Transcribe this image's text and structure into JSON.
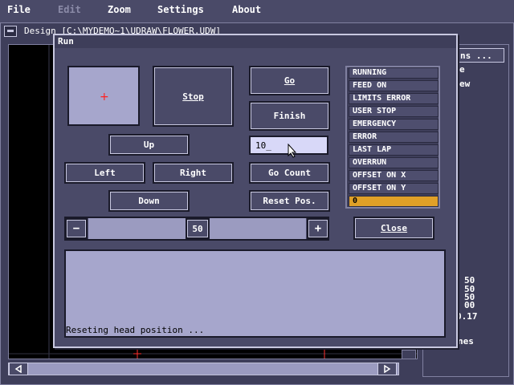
{
  "menu": {
    "file": "File",
    "edit": "Edit",
    "zoom": "Zoom",
    "settings": "Settings",
    "about": "About"
  },
  "background_window": {
    "title": "Design [C:\\MYDEMO~1\\UDRAW\\FLOWER.UDW]",
    "right_panel": {
      "button_label": "ns ...",
      "item1": "e",
      "item2": "ew",
      "values": [
        "50",
        "50",
        "50",
        "00"
      ],
      "value2": "0.17",
      "footer": "nes"
    }
  },
  "run_dialog": {
    "title": "Run",
    "buttons": {
      "stop": "Stop",
      "go": "Go",
      "finish": "Finish",
      "up": "Up",
      "left": "Left",
      "right": "Right",
      "down": "Down",
      "go_count": "Go Count",
      "reset_pos": "Reset Pos.",
      "close": "Close",
      "minus": "−",
      "plus": "+"
    },
    "count_value": "10_",
    "slider_value": "50",
    "slider_fraction": 0.5,
    "message": "Reseting head position ...",
    "status": [
      {
        "label": "RUNNING",
        "active": false
      },
      {
        "label": "FEED ON",
        "active": false
      },
      {
        "label": "LIMITS ERROR",
        "active": false
      },
      {
        "label": "USER STOP",
        "active": false
      },
      {
        "label": "EMERGENCY",
        "active": false
      },
      {
        "label": "ERROR",
        "active": false
      },
      {
        "label": "LAST LAP",
        "active": false
      },
      {
        "label": "OVERRUN",
        "active": false
      },
      {
        "label": "OFFSET ON X",
        "active": false
      },
      {
        "label": "OFFSET ON Y",
        "active": false
      },
      {
        "label": "0",
        "active": true
      }
    ]
  },
  "colors": {
    "panel": "#4a4a68",
    "light_field": "#a6a6cc",
    "status_active": "#e0a028",
    "cursor_mark": "#ff2020"
  },
  "icons": {
    "window_menu": "window-menu-icon",
    "scroll_left": "triangle-left-icon",
    "scroll_right": "triangle-right-icon",
    "crosshair": "plus-icon",
    "pointer": "mouse-pointer-icon"
  }
}
